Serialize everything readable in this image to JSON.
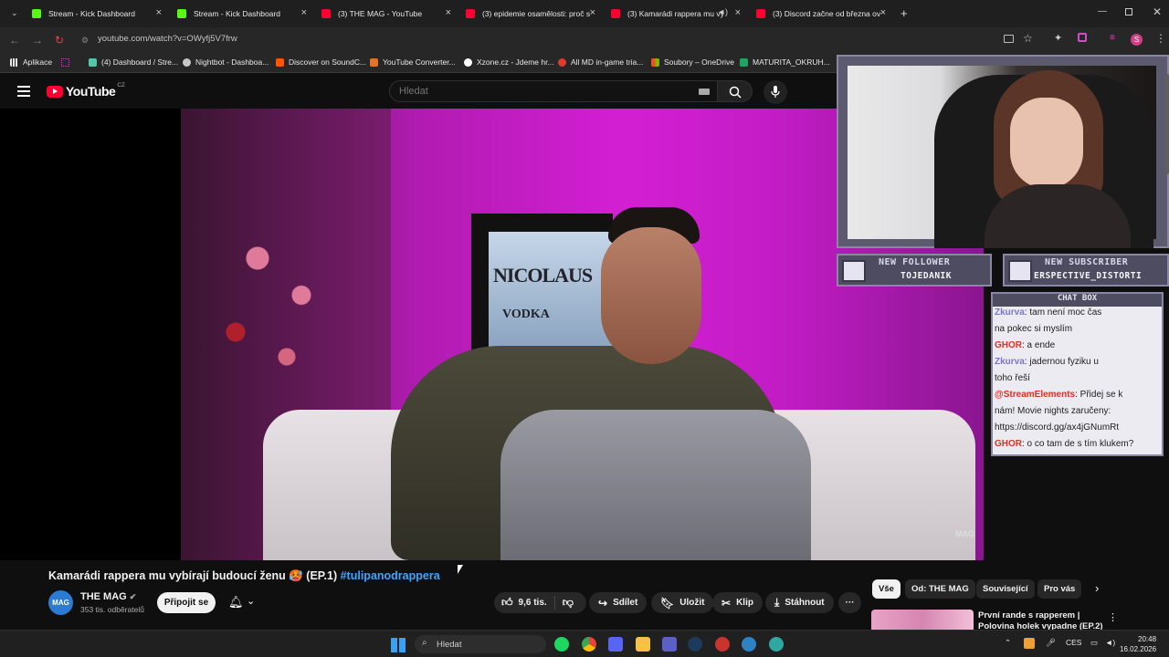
{
  "browser": {
    "tabs": [
      {
        "title": "Stream - Kick Dashboard",
        "favicon": "kick-icon"
      },
      {
        "title": "Stream - Kick Dashboard",
        "favicon": "kick-icon"
      },
      {
        "title": "(3) THE MAG - YouTube",
        "favicon": "youtube-icon"
      },
      {
        "title": "(3) epidemie osamělosti: proč s",
        "favicon": "youtube-icon"
      },
      {
        "title": "(3) Kamarádi rappera mu vy",
        "favicon": "youtube-icon"
      },
      {
        "title": "(3) Discord začne od března ov",
        "favicon": "youtube-icon"
      }
    ],
    "new_tab": "+",
    "url": "youtube.com/watch?v=OWyfj5V7frw",
    "bookmarks": [
      {
        "label": "Aplikace",
        "color": "#e8e8e8"
      },
      {
        "label": "(4) Dashboard / Stre...",
        "color": "#53c6a8"
      },
      {
        "label": "Nightbot - Dashboa...",
        "color": "#c8c8c8"
      },
      {
        "label": "Discover on SoundC...",
        "color": "#ff5500"
      },
      {
        "label": "YouTube Converter...",
        "color": "#e4732a"
      },
      {
        "label": "Xzone.cz - Jdeme hr...",
        "color": "#ffffff"
      },
      {
        "label": "All MD in-game tria...",
        "color": "#e23b2e"
      },
      {
        "label": "Soubory – OneDrive",
        "color": "#f2b01e"
      },
      {
        "label": "MATURITA_OKRUH...",
        "color": "#1fa463"
      }
    ]
  },
  "youtube": {
    "logo_text": "YouTube",
    "region": "CZ",
    "search_placeholder": "Hledat",
    "video_title": "Kamarádi rappera mu vybírají budoucí ženu 🥵 (EP.1)",
    "video_hashtag": "#tulipanodrappera",
    "watermark": "MAG",
    "channel": {
      "avatar_text": "MAG",
      "name": "THE MAG",
      "subs": "353 tis. odběratelů"
    },
    "join_label": "Připojit se",
    "actions": {
      "likes": "9,6 tis.",
      "share": "Sdílet",
      "save": "Uložit",
      "clip": "Klip",
      "download": "Stáhnout"
    },
    "chips": [
      "Vše",
      "Od: THE MAG",
      "Související",
      "Pro vás"
    ],
    "next_video_title": "První rande s rapperem | Polovina holek vypadne (EP.2)"
  },
  "video_scene": {
    "tv_brand": "NICOLAUS",
    "tv_sub": "VODKA"
  },
  "overlay": {
    "follower_label": "NEW FOLLOWER",
    "follower_name": "TOJEDANIK",
    "subscriber_label": "NEW SUBSCRIBER",
    "subscriber_name": "ERSPECTIVE_DISTORTI",
    "chat_title": "CHAT BOX",
    "chat": [
      {
        "user": "Zkurva",
        "color": "#7a78c4",
        "text": ": tam není moc čas"
      },
      {
        "user": "",
        "color": "#1d1d1d",
        "text": "na pokec si myslím"
      },
      {
        "user": "GHOR",
        "color": "#e0301e",
        "text": ": a ende"
      },
      {
        "user": "Zkurva",
        "color": "#7a78c4",
        "text": ": jadernou fyziku u"
      },
      {
        "user": "",
        "color": "#1d1d1d",
        "text": "toho řeší"
      },
      {
        "user": "@StreamElements",
        "color": "#e0301e",
        "text": ": Přidej se k"
      },
      {
        "user": "",
        "color": "#1d1d1d",
        "text": "nám! Movie nights zaručeny:"
      },
      {
        "user": "",
        "color": "#1d1d1d",
        "text": "https://discord.gg/ax4jGNumRt"
      },
      {
        "user": "GHOR",
        "color": "#e0301e",
        "text": ": o co tam de s tím klukem?"
      }
    ]
  },
  "taskbar": {
    "search_placeholder": "Hledat",
    "lang": "CES",
    "time": "20:48",
    "date": "16.02.2026"
  }
}
